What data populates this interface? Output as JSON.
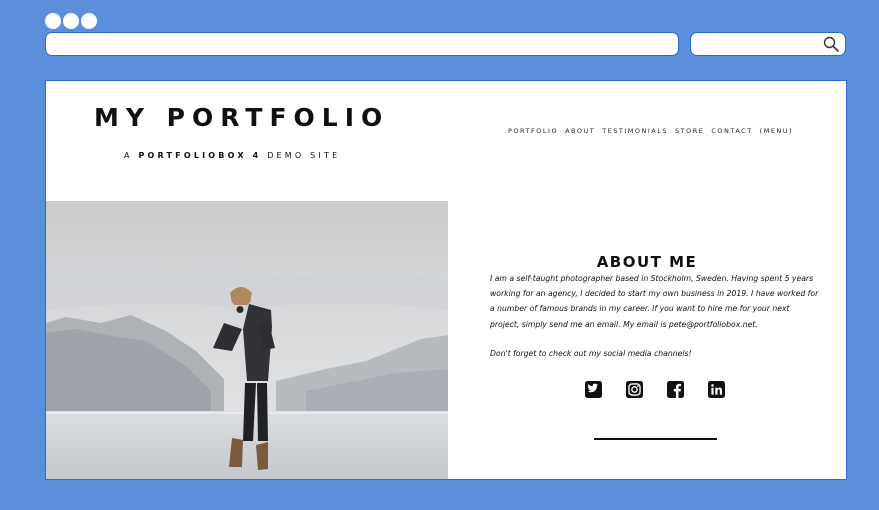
{
  "browser": {
    "url": "",
    "search_placeholder": ""
  },
  "site": {
    "title": "MY PORTFOLIO",
    "subtitle_prefix": "A",
    "subtitle_brand": "PORTFOLIOBOX 4",
    "subtitle_suffix": "DEMO SITE"
  },
  "nav": {
    "items": [
      {
        "label": "PORTFOLIO"
      },
      {
        "label": "ABOUT"
      },
      {
        "label": "TESTIMONIALS"
      },
      {
        "label": "STORE"
      },
      {
        "label": "CONTACT"
      },
      {
        "label": "(MENU)"
      }
    ]
  },
  "about": {
    "heading": "ABOUT ME",
    "paragraph1": "I am a self-taught photographer based in Stockholm, Sweden. Having spent 5 years working for an agency, I decided to start my own business in 2019. I have worked for a number of famous brands in my career. If you want to hire me for your next project, simply send me an email. My email is pete@portfoliobox.net.",
    "paragraph2": "Don't forget to check out my social media channels!"
  },
  "social": [
    "twitter-icon",
    "instagram-icon",
    "facebook-icon",
    "linkedin-icon"
  ],
  "colors": {
    "background": "#5b8fdc",
    "browser_border": "#2d6ad2",
    "text": "#111111"
  }
}
